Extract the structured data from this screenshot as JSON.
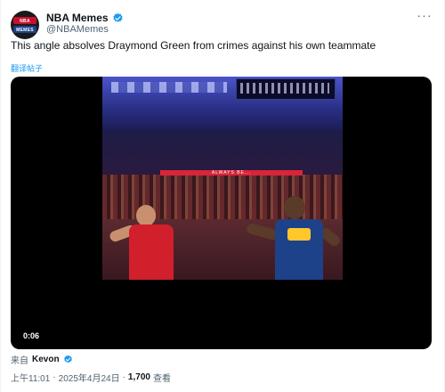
{
  "tweet": {
    "display_name": "NBA Memes",
    "handle": "@NBAMemes",
    "text": "This angle absolves Draymond Green from crimes against his own teammate",
    "translate_label": "翻译帖子",
    "avatar_icon": "nba-memes-logo-icon",
    "avatar_text_top": "NBA",
    "avatar_text_bottom": "MEMES",
    "verified_color": "#1d9bf0"
  },
  "media": {
    "duration": "0:06",
    "scene_banner": "ALWAYS BE..."
  },
  "source": {
    "prefix": "来自",
    "name": "Kevon"
  },
  "meta": {
    "time": "上午11:01",
    "date": "2025年4月24日",
    "views_count": "1,700",
    "views_label": "查看"
  },
  "icons": {
    "more": "more-options-icon",
    "verified": "verified-badge-icon",
    "play": "video-icon"
  }
}
